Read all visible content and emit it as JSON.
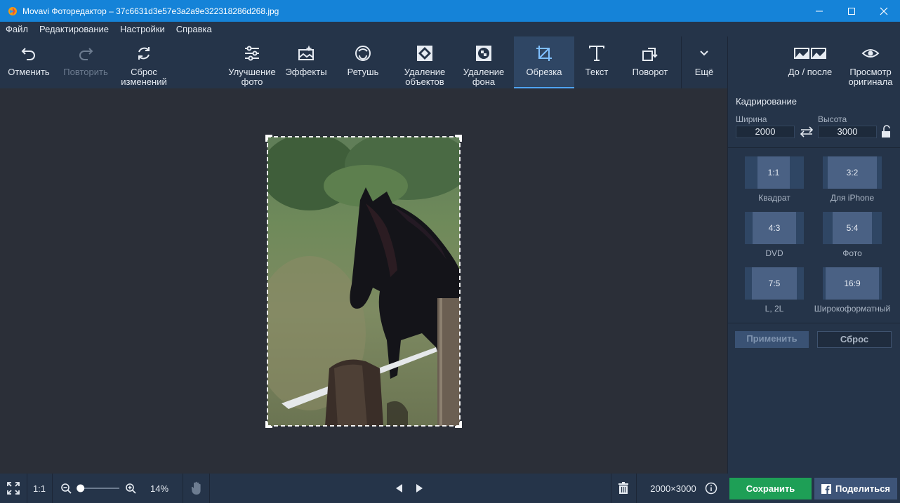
{
  "window": {
    "title": "Movavi Фоторедактор – 37c6631d3e57e3a2a9e322318286d268.jpg",
    "accent": "#1583d8"
  },
  "menu": [
    "Файл",
    "Редактирование",
    "Настройки",
    "Справка"
  ],
  "toolbar": {
    "undo": "Отменить",
    "redo": "Повторить",
    "reset_line1": "Сброс",
    "reset_line2": "изменений",
    "enhance_line1": "Улучшение",
    "enhance_line2": "фото",
    "effects": "Эффекты",
    "retouch": "Ретушь",
    "remove_objects_line1": "Удаление",
    "remove_objects_line2": "объектов",
    "remove_bg_line1": "Удаление",
    "remove_bg_line2": "фона",
    "crop": "Обрезка",
    "text": "Текст",
    "rotate": "Поворот",
    "more": "Ещё",
    "before_after": "До / после",
    "view_original_line1": "Просмотр",
    "view_original_line2": "оригинала"
  },
  "crop_panel": {
    "header": "Кадрирование",
    "width_label": "Ширина",
    "height_label": "Высота",
    "width": "2000",
    "height": "3000",
    "presets": [
      {
        "ratio": "1:1",
        "caption": "Квадрат"
      },
      {
        "ratio": "3:2",
        "caption": "Для iPhone"
      },
      {
        "ratio": "4:3",
        "caption": "DVD"
      },
      {
        "ratio": "5:4",
        "caption": "Фото"
      },
      {
        "ratio": "7:5",
        "caption": "L, 2L"
      },
      {
        "ratio": "16:9",
        "caption": "Широкоформатный"
      }
    ],
    "apply": "Применить",
    "reset": "Сброс"
  },
  "status": {
    "fit_icon": "fit-screen-icon",
    "actual_size": "1:1",
    "zoom": "14%",
    "zoom_level": 0.14,
    "dimensions": "2000×3000",
    "save": "Сохранить",
    "share": "Поделиться"
  }
}
